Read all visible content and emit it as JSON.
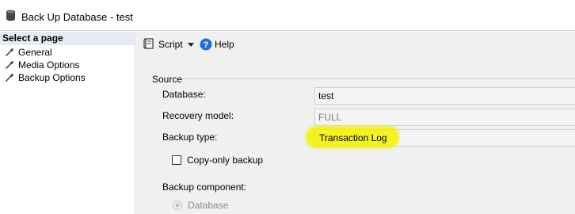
{
  "window": {
    "title": "Back Up Database - test",
    "icon": "database-icon"
  },
  "sidebar": {
    "header": "Select a page",
    "items": [
      {
        "label": "General",
        "icon": "wrench-icon"
      },
      {
        "label": "Media Options",
        "icon": "wrench-icon"
      },
      {
        "label": "Backup Options",
        "icon": "wrench-icon"
      }
    ]
  },
  "toolbar": {
    "script_label": "Script",
    "help_label": "Help"
  },
  "form": {
    "source_label": "Source",
    "database_label": "Database:",
    "database_value": "test",
    "recovery_label": "Recovery model:",
    "recovery_value": "FULL",
    "backup_type_label": "Backup type:",
    "backup_type_value": "Transaction Log",
    "copy_only_label": "Copy-only backup",
    "copy_only_checked": false,
    "component_label": "Backup component:",
    "component_option": "Database"
  },
  "colors": {
    "highlight": "#f2f200",
    "sidebar_header_bg": "#e5eaf3",
    "pane_bg": "#f0f0f0"
  }
}
